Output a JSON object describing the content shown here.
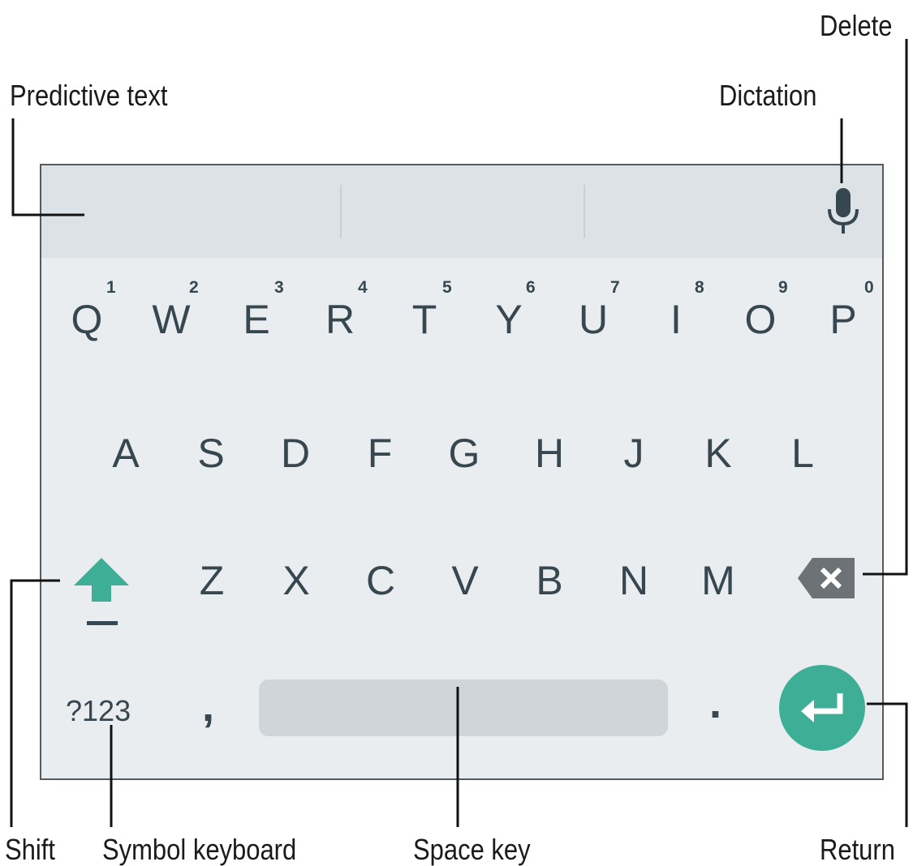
{
  "callouts": {
    "predictive_text": "Predictive text",
    "dictation": "Dictation",
    "delete": "Delete",
    "shift": "Shift",
    "symbol_keyboard": "Symbol keyboard",
    "space_key": "Space key",
    "return": "Return"
  },
  "keyboard": {
    "row1": [
      "Q",
      "W",
      "E",
      "R",
      "T",
      "Y",
      "U",
      "I",
      "O",
      "P"
    ],
    "row1_hints": [
      "1",
      "2",
      "3",
      "4",
      "5",
      "6",
      "7",
      "8",
      "9",
      "0"
    ],
    "row2": [
      "A",
      "S",
      "D",
      "F",
      "G",
      "H",
      "J",
      "K",
      "L"
    ],
    "row3": [
      "Z",
      "X",
      "C",
      "V",
      "B",
      "N",
      "M"
    ],
    "symbol_key": "?123",
    "comma_key": ",",
    "period_key": ".",
    "icons": [
      "microphone-icon",
      "shift-arrow-icon",
      "backspace-icon",
      "enter-arrow-icon"
    ]
  },
  "colors": {
    "accent": "#3fae96",
    "key_text": "#37474f",
    "keyboard_bg": "#e9edf0",
    "suggestion_bar_bg": "#dde2e6",
    "space_bar": "#cfd5d9",
    "delete_key": "#6c7276"
  }
}
